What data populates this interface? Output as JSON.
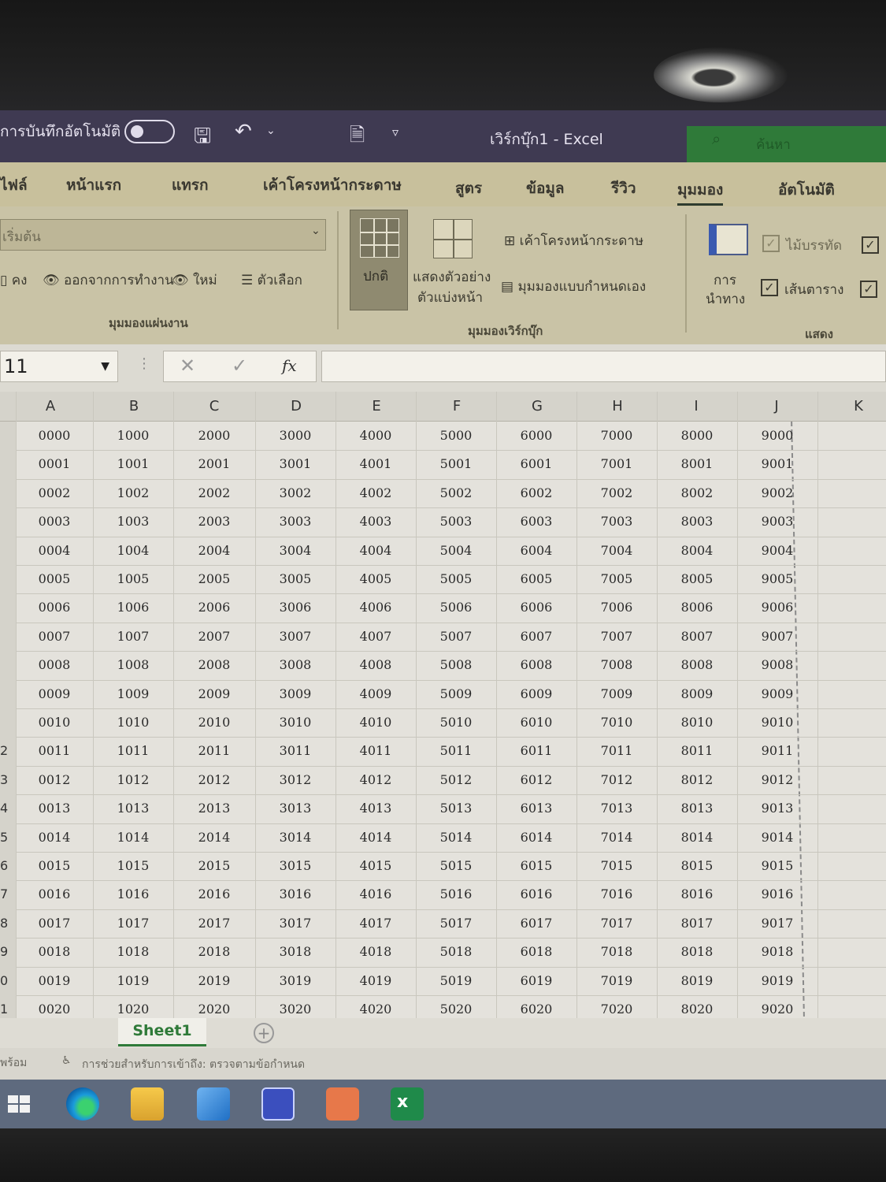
{
  "titlebar": {
    "autosave_label": "การบันทึกอัตโนมัติ",
    "doc_title": "เวิร์กบุ๊ก1  -  Excel",
    "search_label": "ค้นหา"
  },
  "tabs": [
    "ไฟล์",
    "หน้าแรก",
    "แทรก",
    "เค้าโครงหน้ากระดาษ",
    "สูตร",
    "ข้อมูล",
    "รีวิว",
    "มุมมอง",
    "อัตโนมัติ"
  ],
  "active_tab": "มุมมอง",
  "ribbon": {
    "sheetview_dropdown": "เริ่มต้น",
    "keep": "คง",
    "exit": "ออกจากการทำงาน",
    "new": "ใหม่",
    "options": "ตัวเลือก",
    "sheetview_group": "มุมมองแผ่นงาน",
    "normal": "ปกติ",
    "pagebreak_1": "แสดงตัวอย่าง",
    "pagebreak_2": "ตัวแบ่งหน้า",
    "page_layout": "เค้าโครงหน้ากระดาษ",
    "custom_views": "มุมมองแบบกำหนดเอง",
    "workbook_views_group": "มุมมองเวิร์กบุ๊ก",
    "navigation_1": "การ",
    "navigation_2": "นำทาง",
    "ruler": "ไม้บรรทัด",
    "gridlines": "เส้นตาราง",
    "show_group": "แสดง"
  },
  "formula_bar": {
    "namebox": "11",
    "fx": "fx"
  },
  "columns": [
    "A",
    "B",
    "C",
    "D",
    "E",
    "F",
    "G",
    "H",
    "I",
    "J",
    "K"
  ],
  "row_headers": [
    "",
    "",
    "",
    "",
    "",
    "",
    "",
    "",
    "",
    "",
    "",
    "2",
    "3",
    "4",
    "5",
    "6",
    "7",
    "8",
    "9",
    "0",
    "1"
  ],
  "rows": [
    [
      "0000",
      "1000",
      "2000",
      "3000",
      "4000",
      "5000",
      "6000",
      "7000",
      "8000",
      "9000"
    ],
    [
      "0001",
      "1001",
      "2001",
      "3001",
      "4001",
      "5001",
      "6001",
      "7001",
      "8001",
      "9001"
    ],
    [
      "0002",
      "1002",
      "2002",
      "3002",
      "4002",
      "5002",
      "6002",
      "7002",
      "8002",
      "9002"
    ],
    [
      "0003",
      "1003",
      "2003",
      "3003",
      "4003",
      "5003",
      "6003",
      "7003",
      "8003",
      "9003"
    ],
    [
      "0004",
      "1004",
      "2004",
      "3004",
      "4004",
      "5004",
      "6004",
      "7004",
      "8004",
      "9004"
    ],
    [
      "0005",
      "1005",
      "2005",
      "3005",
      "4005",
      "5005",
      "6005",
      "7005",
      "8005",
      "9005"
    ],
    [
      "0006",
      "1006",
      "2006",
      "3006",
      "4006",
      "5006",
      "6006",
      "7006",
      "8006",
      "9006"
    ],
    [
      "0007",
      "1007",
      "2007",
      "3007",
      "4007",
      "5007",
      "6007",
      "7007",
      "8007",
      "9007"
    ],
    [
      "0008",
      "1008",
      "2008",
      "3008",
      "4008",
      "5008",
      "6008",
      "7008",
      "8008",
      "9008"
    ],
    [
      "0009",
      "1009",
      "2009",
      "3009",
      "4009",
      "5009",
      "6009",
      "7009",
      "8009",
      "9009"
    ],
    [
      "0010",
      "1010",
      "2010",
      "3010",
      "4010",
      "5010",
      "6010",
      "7010",
      "8010",
      "9010"
    ],
    [
      "0011",
      "1011",
      "2011",
      "3011",
      "4011",
      "5011",
      "6011",
      "7011",
      "8011",
      "9011"
    ],
    [
      "0012",
      "1012",
      "2012",
      "3012",
      "4012",
      "5012",
      "6012",
      "7012",
      "8012",
      "9012"
    ],
    [
      "0013",
      "1013",
      "2013",
      "3013",
      "4013",
      "5013",
      "6013",
      "7013",
      "8013",
      "9013"
    ],
    [
      "0014",
      "1014",
      "2014",
      "3014",
      "4014",
      "5014",
      "6014",
      "7014",
      "8014",
      "9014"
    ],
    [
      "0015",
      "1015",
      "2015",
      "3015",
      "4015",
      "5015",
      "6015",
      "7015",
      "8015",
      "9015"
    ],
    [
      "0016",
      "1016",
      "2016",
      "3016",
      "4016",
      "5016",
      "6016",
      "7016",
      "8016",
      "9016"
    ],
    [
      "0017",
      "1017",
      "2017",
      "3017",
      "4017",
      "5017",
      "6017",
      "7017",
      "8017",
      "9017"
    ],
    [
      "0018",
      "1018",
      "2018",
      "3018",
      "4018",
      "5018",
      "6018",
      "7018",
      "8018",
      "9018"
    ],
    [
      "0019",
      "1019",
      "2019",
      "3019",
      "4019",
      "5019",
      "6019",
      "7019",
      "8019",
      "9019"
    ],
    [
      "0020",
      "1020",
      "2020",
      "3020",
      "4020",
      "5020",
      "6020",
      "7020",
      "8020",
      "9020"
    ]
  ],
  "sheet_tab": "Sheet1",
  "status": {
    "ready": "พร้อม",
    "accessibility": "การช่วยสำหรับการเข้าถึง: ตรวจตามข้อกำหนด"
  },
  "taskbar_icons": [
    "windows-start-icon",
    "edge-icon",
    "file-explorer-icon",
    "mail-icon",
    "teams-icon",
    "powerpoint-icon",
    "excel-icon"
  ],
  "colors": {
    "accent_green": "#2f7a39",
    "titlebar": "#3f3a52",
    "ribbon": "#c9c3a6"
  }
}
